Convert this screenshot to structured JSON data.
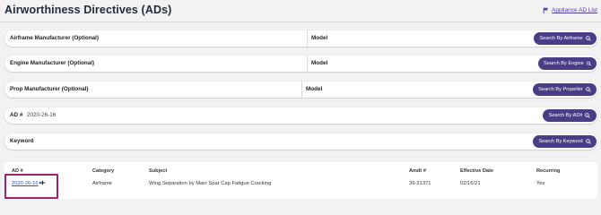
{
  "header": {
    "title": "Airworthiness Directives (ADs)",
    "appliance_link": "Appliance AD List"
  },
  "search_rows": [
    {
      "label": "Airframe Manufacturer (Optional)",
      "model_label": "Model",
      "button": "Search By Airframe"
    },
    {
      "label": "Engine Manufacturer (Optional)",
      "model_label": "Model",
      "button": "Search By Engine"
    },
    {
      "label": "Prop Manufacturer (Optional)",
      "model_label": "Model",
      "button": "Search By Propeller"
    },
    {
      "label": "AD #",
      "value": "2020-26-16",
      "button": "Search By AD#"
    },
    {
      "label": "Keyword",
      "button": "Search By Keyword"
    }
  ],
  "results": {
    "columns": [
      "AD #",
      "Category",
      "Subject",
      "Amdt #",
      "Effective Date",
      "Recurring"
    ],
    "rows": [
      {
        "ad_number": "2020-26-16",
        "category": "Airframe",
        "subject": "Wing Separation by Main Spar Cap Fatigue Cracking",
        "amdt": "39-21371",
        "effective_date": "02/16/21",
        "recurring": "Yes"
      }
    ]
  },
  "colors": {
    "button_bg": "#4b3c86",
    "link": "#2a56c6",
    "highlight_border": "#a0226e"
  },
  "icons": [
    "flag-icon",
    "search-icon",
    "airplane-icon"
  ]
}
